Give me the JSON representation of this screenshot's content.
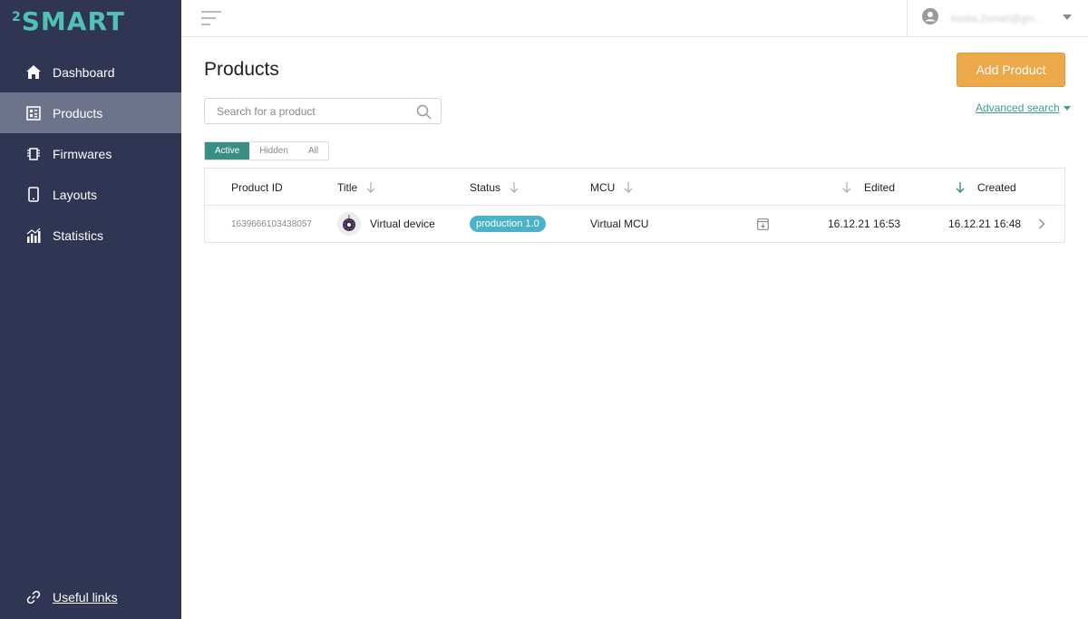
{
  "app": {
    "logo_sup": "2",
    "logo_text": "SMART"
  },
  "sidebar": {
    "items": [
      {
        "label": "Dashboard",
        "icon": "home-icon",
        "active": false
      },
      {
        "label": "Products",
        "icon": "products-icon",
        "active": true
      },
      {
        "label": "Firmwares",
        "icon": "chip-icon",
        "active": false
      },
      {
        "label": "Layouts",
        "icon": "phone-icon",
        "active": false
      },
      {
        "label": "Statistics",
        "icon": "chart-icon",
        "active": false
      }
    ],
    "footer_link": "Useful links"
  },
  "topbar": {
    "user_email": "kostia.2smart@gm..."
  },
  "main": {
    "title": "Products",
    "add_button": "Add Product",
    "search_placeholder": "Search for a product",
    "advanced_search": "Advanced search",
    "tabs": [
      "Active",
      "Hidden",
      "All"
    ],
    "active_tab": "Active"
  },
  "table": {
    "columns": {
      "product_id": "Product ID",
      "title": "Title",
      "status": "Status",
      "mcu": "MCU",
      "edited": "Edited",
      "created": "Created"
    },
    "rows": [
      {
        "product_id": "1639666103438057",
        "title": "Virtual device",
        "status": "production 1.0",
        "mcu": "Virtual MCU",
        "edited": "16.12.21 16:53",
        "created": "16.12.21 16:48"
      }
    ]
  },
  "colors": {
    "sidebar_bg": "#2f3552",
    "sidebar_active": "#6d738a",
    "accent_teal": "#3a8f84",
    "logo": "#4fc2b5",
    "add_button": "#eda84a",
    "status_badge": "#4bb3c7"
  }
}
